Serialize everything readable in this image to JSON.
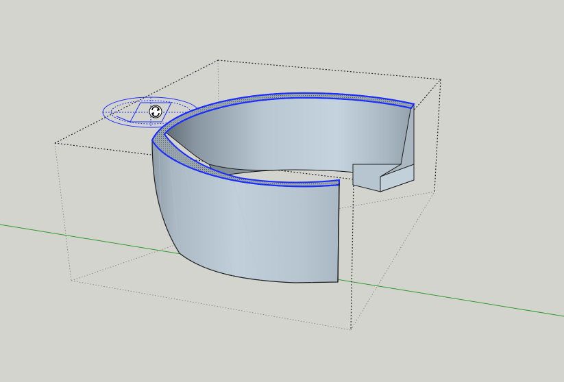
{
  "app": {
    "type": "3d-modeling-viewport",
    "background_color": "#d4d4ce"
  },
  "colors": {
    "green_axis": "#2e9a2e",
    "bounding_box_solid": "#222222",
    "bounding_box_hidden": "#8a8a8a",
    "selection_edge": "#1a2cff",
    "face_light": "#bccbd6",
    "face_mid": "#aebecb",
    "face_dark": "#8e9ca6",
    "inner_face": "#b7c4cf",
    "top_face": "#9aa8b0",
    "shadow_face": "#6f7b83",
    "edge": "#1e1e1e"
  },
  "icons": {
    "rotate_gizmo": "rotate-protractor-icon",
    "rotate_cursor": "rotate-cursor-icon"
  },
  "scene": {
    "object": "selected-arc-extrusion-component",
    "tool": "rotate"
  }
}
